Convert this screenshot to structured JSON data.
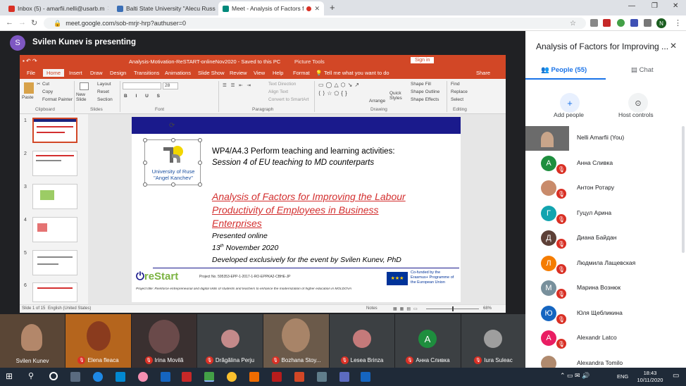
{
  "browser": {
    "tabs": [
      {
        "label": "Inbox (5) - amarfii.nelli@usarb.m",
        "active": false,
        "fav_color": "#d93025"
      },
      {
        "label": "Balti State University \"Alecu Russ",
        "active": false,
        "fav_color": "#3b6fb6"
      },
      {
        "label": "Meet - Analysis of Factors for",
        "active": true,
        "fav_color": "#00897b"
      }
    ],
    "new_tab": "+",
    "url": "meet.google.com/sob-mrjr-hrp?authuser=0",
    "profile_initial": "N"
  },
  "meet": {
    "presenter_initial": "S",
    "presenting_text": "Svilen Kunev is presenting"
  },
  "ppt": {
    "title": "Analysis-Motivation-ReSTART-onlineNov2020  -  Saved to this PC",
    "picture_tools": "Picture Tools",
    "sign_in": "Sign in",
    "menu": [
      "File",
      "Home",
      "Insert",
      "Draw",
      "Design",
      "Transitions",
      "Animations",
      "Slide Show",
      "Review",
      "View",
      "Help",
      "Format"
    ],
    "tell_me": "Tell me what you want to do",
    "share": "Share",
    "ribbon": {
      "paste": "Paste",
      "cut": "Cut",
      "copy": "Copy",
      "format_painter": "Format Painter",
      "clipboard": "Clipboard",
      "new_slide": "New Slide",
      "layout": "Layout",
      "reset": "Reset",
      "section": "Section",
      "slides": "Slides",
      "font": "Font",
      "paragraph": "Paragraph",
      "text_direction": "Text Direction",
      "align_text": "Align Text",
      "convert_smartart": "Convert to SmartArt",
      "arrange": "Arrange",
      "quick_styles": "Quick Styles",
      "shape_fill": "Shape Fill",
      "shape_outline": "Shape Outline",
      "shape_effects": "Shape Effects",
      "drawing": "Drawing",
      "find": "Find",
      "replace": "Replace",
      "select": "Select",
      "editing": "Editing",
      "font_size": "28"
    },
    "thumb_numbers": [
      "1",
      "2",
      "3",
      "4",
      "5",
      "6"
    ],
    "slide": {
      "logo_line1": "University of Ruse",
      "logo_line2": "\"Angel Kanchev\"",
      "heading1": "WP4/A4.3 Perform teaching and learning activities:",
      "heading2": "Session 4 of  EU teaching to MD counterparts",
      "title": "Analysis of Factors for Improving the Labour Productivity of Employees in Business Enterprises",
      "presented": "Presented online",
      "date_day": "13",
      "date_sup": "th",
      "date_rest": " November 2020",
      "developed": "Developed exclusively for the event by Svilen Kunev, PhD",
      "restart_logo": "reStart",
      "project_no": "Project No. 595353-EPP-1-2017-1-RO-EPPKA2-CBHE-JP",
      "eu_text": "Co-funded by the Erasmus+ Programme of the European Union",
      "project_title": "Project title: Reinforce entrepreneurial and digital skills of students and teachers to enhance the modernization of higher education in MOLDOVA"
    },
    "status_left": "Slide 1 of 15",
    "status_lang": "English (United States)",
    "notes": "Notes",
    "zoom": "68%"
  },
  "panel": {
    "title": "Analysis of Factors for Improving ...",
    "people_tab": "People (55)",
    "chat_tab": "Chat",
    "add_people": "Add people",
    "host_controls": "Host controls",
    "accent": "#1a73e8",
    "participants": [
      {
        "name": "Nelli Amarfii (You)",
        "initial": "",
        "color": "#6b6b6b",
        "muted": false,
        "photo": true
      },
      {
        "name": "Анна Сливка",
        "initial": "А",
        "color": "#1e8e3e",
        "muted": true
      },
      {
        "name": "Антон Ротару",
        "initial": "",
        "color": "#c98b6b",
        "muted": true,
        "photo": true
      },
      {
        "name": "Гуцул Арина",
        "initial": "Г",
        "color": "#12a4af",
        "muted": true
      },
      {
        "name": "Диана Байдан",
        "initial": "Д",
        "color": "#5d4037",
        "muted": true
      },
      {
        "name": "Людмила Лащевская",
        "initial": "Л",
        "color": "#f57c00",
        "muted": true
      },
      {
        "name": "Марина Вознюк",
        "initial": "М",
        "color": "#78909c",
        "muted": true
      },
      {
        "name": "Юля Щебликина",
        "initial": "Ю",
        "color": "#1565c0",
        "muted": true
      },
      {
        "name": "Alexandr Latco",
        "initial": "A",
        "color": "#e91e63",
        "muted": true
      },
      {
        "name": "Alexandra Tomilo",
        "initial": "",
        "color": "#b08a6e",
        "muted": false,
        "photo": true
      }
    ]
  },
  "filmstrip": [
    {
      "name": "Svilen Kunev",
      "muted": false,
      "bg": "#5a4636",
      "initial": ""
    },
    {
      "name": "Elena fleaca",
      "muted": true,
      "bg": "#b5651d",
      "initial": ""
    },
    {
      "name": "Irina Movilă",
      "muted": true,
      "bg": "#3a3030",
      "initial": ""
    },
    {
      "name": "Drăgălina Perju",
      "muted": true,
      "bg": "#3c4043",
      "initial": ""
    },
    {
      "name": "Bozhana Stoy...",
      "muted": true,
      "bg": "#6b5a4a",
      "initial": ""
    },
    {
      "name": "Lesea Brinza",
      "muted": true,
      "bg": "#3c4043",
      "initial": ""
    },
    {
      "name": "Анна Сливка",
      "muted": true,
      "bg": "#3c4043",
      "initial": "А"
    },
    {
      "name": "Iura Suleac",
      "muted": true,
      "bg": "#3c4043",
      "initial": ""
    }
  ],
  "taskbar": {
    "lang": "ENG",
    "time": "18:43",
    "date": "10/11/2020"
  }
}
